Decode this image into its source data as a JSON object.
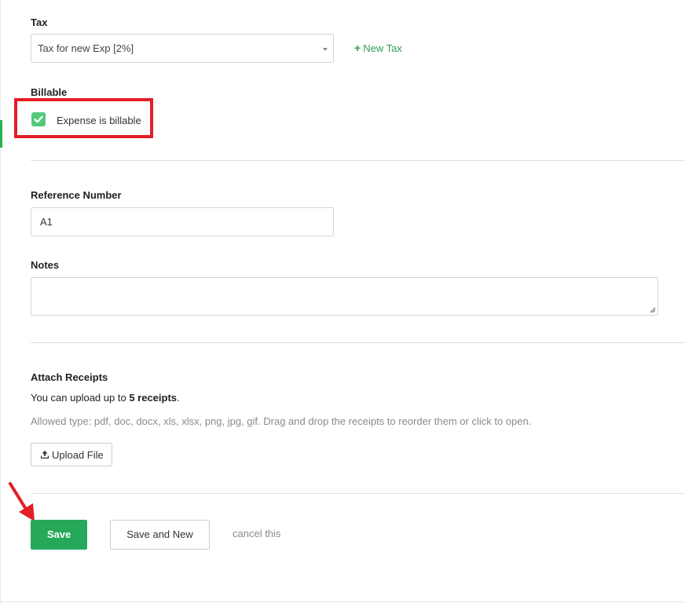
{
  "tax": {
    "label": "Tax",
    "selected": "Tax for new Exp [2%]",
    "new_tax_label": "New Tax"
  },
  "billable": {
    "label": "Billable",
    "checkbox_label": "Expense is billable",
    "checked": true
  },
  "reference": {
    "label": "Reference Number",
    "value": "A1"
  },
  "notes": {
    "label": "Notes",
    "value": ""
  },
  "receipts": {
    "label": "Attach Receipts",
    "upload_text_prefix": "You can upload up to",
    "upload_limit": "5 receipts",
    "upload_text_suffix": ".",
    "allowed_text": "Allowed type: pdf, doc, docx, xls, xlsx, png, jpg, gif. Drag and drop the receipts to reorder them or click to open.",
    "upload_button": "Upload File"
  },
  "actions": {
    "save": "Save",
    "save_and_new": "Save and New",
    "cancel": "cancel this"
  },
  "colors": {
    "primary_green": "#26a85a",
    "checkbox_green": "#54c97a",
    "link_green": "#2e9e5b",
    "annotation_red": "#e41e26"
  }
}
